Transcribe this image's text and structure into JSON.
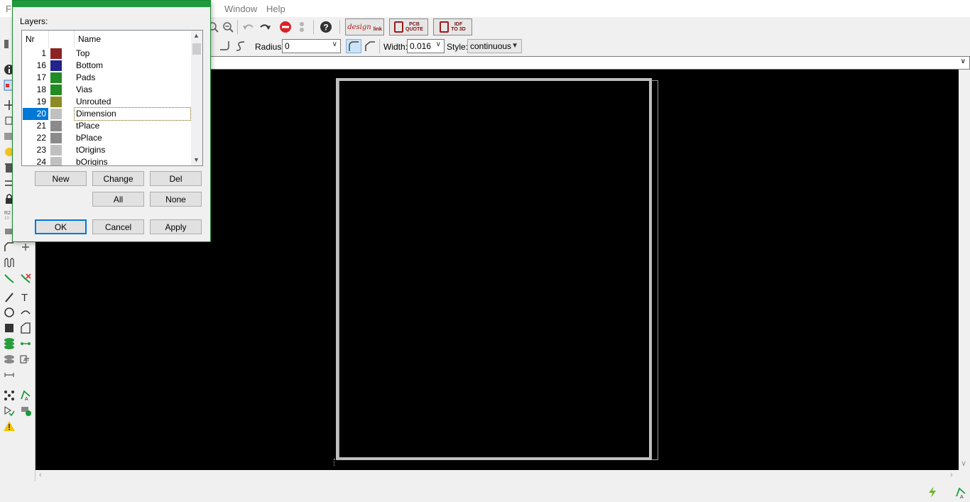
{
  "menubar": {
    "items": [
      "F",
      "Window",
      "Help"
    ]
  },
  "toolbar2": {
    "radius_label": "Radius:",
    "radius_value": "0",
    "width_label": "Width:",
    "width_value": "0.016",
    "style_label": "Style:",
    "style_value": "continuous"
  },
  "brand_buttons": {
    "design_link": {
      "script": "design",
      "sub": "link"
    },
    "pcb_quote": {
      "line1": "PCB",
      "line2": "QUOTE"
    },
    "idf_to_3d": {
      "line1": "IDF",
      "line2": "TO 3D"
    }
  },
  "dialog": {
    "layers_label": "Layers:",
    "columns": {
      "nr": "Nr",
      "name": "Name"
    },
    "layers": [
      {
        "nr": "1",
        "name": "Top",
        "color": "#8b2323"
      },
      {
        "nr": "16",
        "name": "Bottom",
        "color": "#23238b"
      },
      {
        "nr": "17",
        "name": "Pads",
        "color": "#238b23"
      },
      {
        "nr": "18",
        "name": "Vias",
        "color": "#238b23"
      },
      {
        "nr": "19",
        "name": "Unrouted",
        "color": "#8b8b23"
      },
      {
        "nr": "20",
        "name": "Dimension",
        "color": "#c0c0c0",
        "selected": true
      },
      {
        "nr": "21",
        "name": "tPlace",
        "color": "#8b8b8b"
      },
      {
        "nr": "22",
        "name": "bPlace",
        "color": "#8b8b8b"
      },
      {
        "nr": "23",
        "name": "tOrigins",
        "color": "#c0c0c0"
      },
      {
        "nr": "24",
        "name": "bOrigins",
        "color": "#c0c0c0"
      }
    ],
    "buttons": {
      "new": "New",
      "change": "Change",
      "del": "Del",
      "all": "All",
      "none": "None",
      "ok": "OK",
      "cancel": "Cancel",
      "apply": "Apply"
    }
  },
  "colors": {
    "canvas_bg": "#000000",
    "board_outline": "#c0c0c0",
    "dialog_title": "#1e9b3a",
    "selection": "#0078d7"
  },
  "icons": {
    "toolbar": [
      "zoom-in-icon",
      "zoom-out-icon",
      "undo-icon",
      "redo-icon",
      "stop-icon",
      "go-icon",
      "help-icon"
    ],
    "lefttools": [
      "info-icon",
      "display-icon",
      "move-icon",
      "copy-icon",
      "group-icon",
      "delete-icon",
      "mirror-icon",
      "lock-icon",
      "name-icon",
      "value-icon",
      "smash-icon",
      "miter-icon",
      "split-icon",
      "optimize-icon",
      "route-icon",
      "ripup-icon",
      "wire-icon",
      "text-icon",
      "circle-icon",
      "arc-icon",
      "rect-icon",
      "polygon-icon",
      "via-icon",
      "signal-icon",
      "hole-icon",
      "attribute-icon",
      "dimension-icon",
      "ratsnest-icon",
      "autorouter-icon",
      "erc-icon",
      "drc-icon",
      "errors-icon"
    ],
    "statusbar": [
      "lightning-icon",
      "autorouter-status-icon"
    ]
  }
}
